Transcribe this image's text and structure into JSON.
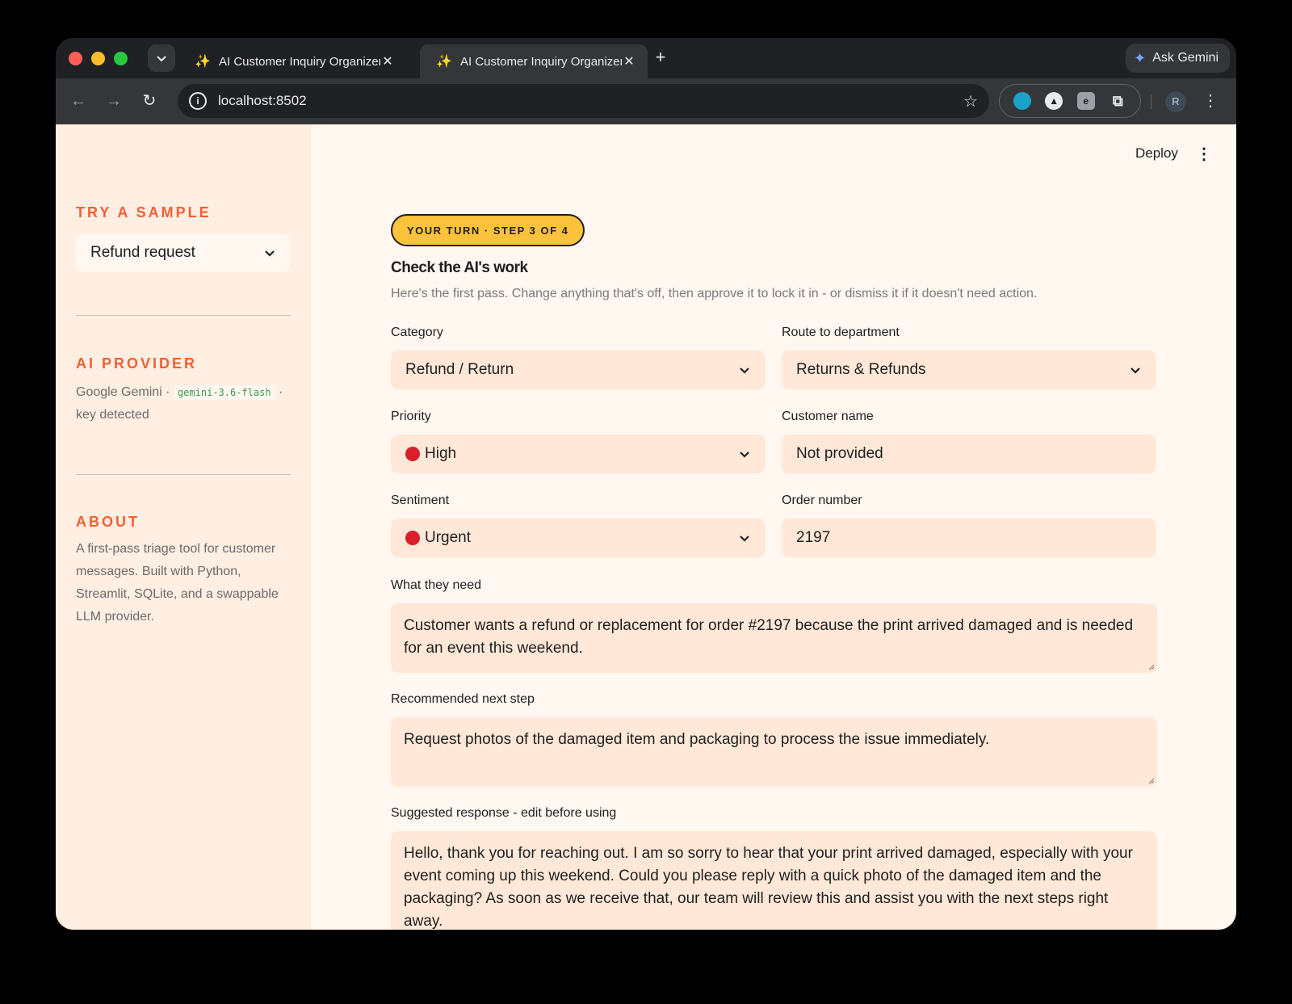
{
  "browser": {
    "tabs": [
      {
        "title": "AI Customer Inquiry Organizer",
        "active": false
      },
      {
        "title": "AI Customer Inquiry Organizer",
        "active": true
      }
    ],
    "ask_gemini": "Ask Gemini",
    "url": "localhost:8502",
    "profile_initial": "R"
  },
  "sidebar": {
    "sample_title": "TRY A SAMPLE",
    "sample_selected": "Refund request",
    "provider_title": "AI PROVIDER",
    "provider_name": "Google Gemini",
    "provider_sep1": "·",
    "provider_model": "gemini-3.6-flash",
    "provider_sep2": "·",
    "provider_status": "key detected",
    "about_title": "ABOUT",
    "about_text": "A first-pass triage tool for customer messages. Built with Python, Streamlit, SQLite, and a swappable LLM provider."
  },
  "header": {
    "deploy": "Deploy"
  },
  "main": {
    "badge": "YOUR TURN · STEP 3 OF 4",
    "title": "Check the AI's work",
    "subtitle": "Here's the first pass. Change anything that's off, then approve it to lock it in - or dismiss it if it doesn't need action.",
    "fields": {
      "category": {
        "label": "Category",
        "value": "Refund / Return"
      },
      "department": {
        "label": "Route to department",
        "value": "Returns & Refunds"
      },
      "priority": {
        "label": "Priority",
        "value": "High"
      },
      "customer_name": {
        "label": "Customer name",
        "value": "Not provided"
      },
      "sentiment": {
        "label": "Sentiment",
        "value": "Urgent"
      },
      "order_number": {
        "label": "Order number",
        "value": "2197"
      },
      "need": {
        "label": "What they need",
        "value": "Customer wants a refund or replacement for order #2197 because the print arrived damaged and is needed for an event this weekend."
      },
      "next_step": {
        "label": "Recommended next step",
        "value": "Request photos of the damaged item and packaging to process the issue immediately."
      },
      "response": {
        "label": "Suggested response - edit before using",
        "value": "Hello, thank you for reaching out. I am so sorry to hear that your print arrived damaged, especially with your event coming up this weekend. Could you please reply with a quick photo of the damaged item and the packaging? As soon as we receive that, our team will review this and assist you with the next steps right away."
      }
    }
  },
  "colors": {
    "accent": "#f25f33",
    "badge": "#fcc23c",
    "field_bg": "#ffe8d8",
    "status_red": "#d81f2a"
  }
}
